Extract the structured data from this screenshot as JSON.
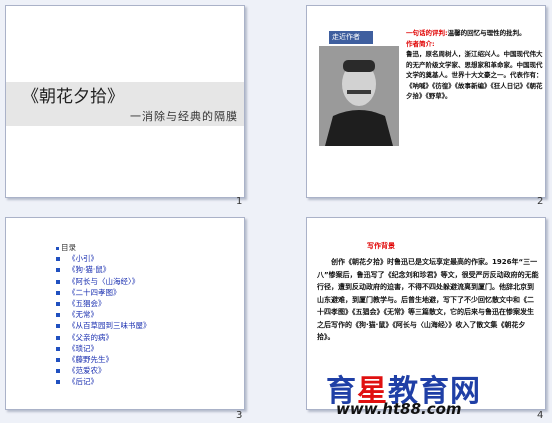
{
  "slides": [
    {
      "number": "1",
      "title": "《朝花夕拾》",
      "subtitle": "一消除与经典的隔膜"
    },
    {
      "number": "2",
      "header_tab": "走近作者",
      "intro_label": "一句话的评判:",
      "intro_text": "温馨的回忆与理性的批判。",
      "bio_label": "作者简介:",
      "bio_text": "鲁迅，原名周树人，浙江绍兴人。中国现代伟大的无产阶级文学家、思想家和革命家。中国现代文学的奠基人。世界十大文豪之一。代表作有：《呐喊》《彷徨》《故事新编》《狂人日记》《朝花夕拾》《野草》。"
    },
    {
      "number": "3",
      "list_heading": "目录",
      "items": [
        "《小引》",
        "《狗·猫·鼠》",
        "《阿长与〈山海经〉》",
        "《二十四孝图》",
        "《五猖会》",
        "《无常》",
        "《从百草园到三味书屋》",
        "《父亲的病》",
        "《琐记》",
        "《藤野先生》",
        "《范爱农》",
        "《后记》"
      ]
    },
    {
      "number": "4",
      "heading": "写作背景",
      "body": "创作《朝花夕拾》时鲁迅已是文坛享定最高的作家。1926年“三一八”惨案后，鲁迅写了《纪念刘和珍君》等文，很受严厉反动政府的无能行径，遭到反动政府的迫害，不得不四处躲避流离到厦门。他辞北京到山东避难，到厦门教学与。后曾生地避，写下了不少回忆散文中和《二十四孝图》《五猖会》《无常》等三篇散文，它的后来与鲁迅在惨案发生之后写作的《狗·猫·鼠》《阿长与〈山海经〉》收入了散文集《朝花夕拾》。"
    }
  ],
  "watermark": {
    "brand_part1": "育",
    "brand_accent": "星",
    "brand_part2": "教育网",
    "site": "www.ht88.com",
    "color_blue": "#1f3fa6",
    "color_red": "#e01010"
  }
}
